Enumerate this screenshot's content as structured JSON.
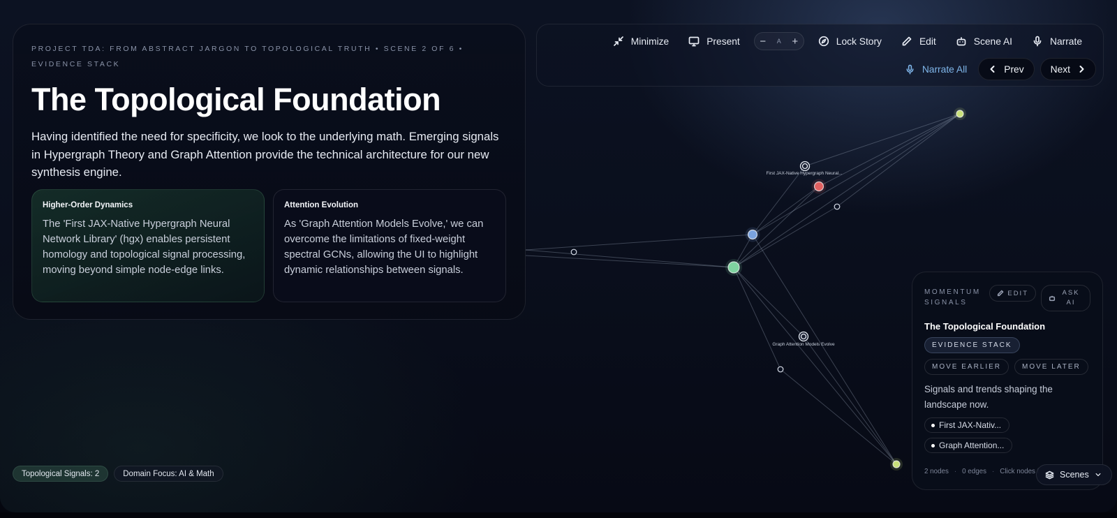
{
  "hero": {
    "breadcrumb": "PROJECT TDA: FROM ABSTRACT JARGON TO TOPOLOGICAL TRUTH • SCENE 2 OF 6 • EVIDENCE STACK",
    "title": "The Topological Foundation",
    "lede": "Having identified the need for specificity, we look to the underlying math. Emerging signals in Hypergraph Theory and Graph Attention provide the technical architecture for our new synthesis engine.",
    "cards": [
      {
        "title": "Higher-Order Dynamics",
        "body": "The 'First JAX-Native Hypergraph Neural Network Library' (hgx) enables persistent homology and topological signal processing, moving beyond simple node-edge links."
      },
      {
        "title": "Attention Evolution",
        "body": "As 'Graph Attention Models Evolve,' we can overcome the limitations of fixed-weight spectral GCNs, allowing the UI to highlight dynamic relationships between signals."
      }
    ]
  },
  "toolbar": {
    "minimize": "Minimize",
    "present": "Present",
    "zoom_label": "A",
    "zoom_minus": "−",
    "zoom_plus": "+",
    "lock_story": "Lock Story",
    "edit": "Edit",
    "scene_ai": "Scene AI",
    "narrate": "Narrate",
    "narrate_all": "Narrate All",
    "prev": "Prev",
    "next": "Next"
  },
  "graph": {
    "node_labels": [
      "First JAX-Native Hypergraph Neural...",
      "Graph Attention Models Evolve"
    ],
    "colors": {
      "green": "#7fd3a0",
      "blue": "#7aa3e0",
      "red": "#e06060",
      "lime": "#c9e07a",
      "edge": "#a8b3c8"
    }
  },
  "panel": {
    "kicker": "MOMENTUM SIGNALS",
    "edit": "EDIT",
    "ask_ai": "ASK AI",
    "title": "The Topological Foundation",
    "tag_active": "EVIDENCE STACK",
    "move_earlier": "MOVE EARLIER",
    "move_later": "MOVE LATER",
    "desc": "Signals and trends shaping the landscape now.",
    "chips": [
      "First JAX-Nativ...",
      "Graph Attention..."
    ],
    "foot_nodes": "2 nodes",
    "foot_edges": "0 edges",
    "foot_hint": "Click nodes f"
  },
  "scenes": "Scenes",
  "footer": {
    "chip1": "Topological Signals: 2",
    "chip2": "Domain Focus: AI & Math"
  }
}
